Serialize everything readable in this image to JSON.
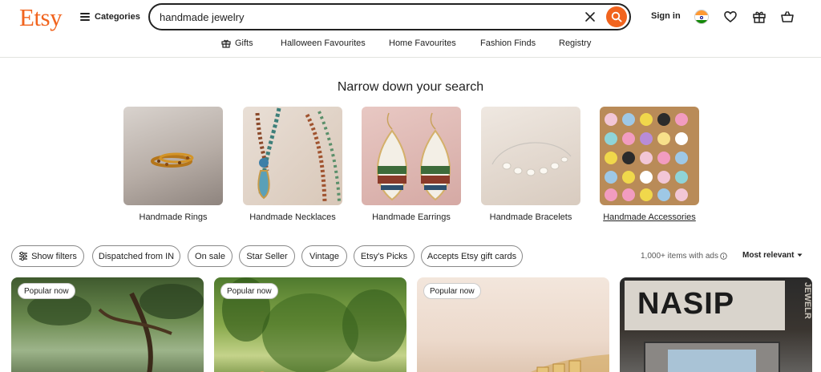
{
  "header": {
    "logo": "Etsy",
    "categories_label": "Categories",
    "search_value": "handmade jewelry",
    "signin_label": "Sign in"
  },
  "nav": {
    "items": [
      {
        "label": "Gifts"
      },
      {
        "label": "Halloween Favourites"
      },
      {
        "label": "Home Favourites"
      },
      {
        "label": "Fashion Finds"
      },
      {
        "label": "Registry"
      }
    ]
  },
  "narrow": {
    "title": "Narrow down your search",
    "items": [
      {
        "label": "Handmade Rings"
      },
      {
        "label": "Handmade Necklaces"
      },
      {
        "label": "Handmade Earrings"
      },
      {
        "label": "Handmade Bracelets"
      },
      {
        "label": "Handmade Accessories"
      }
    ]
  },
  "filters": {
    "show_filters": "Show filters",
    "chips": [
      "Dispatched from IN",
      "On sale",
      "Star Seller",
      "Vintage",
      "Etsy's Picks",
      "Accepts Etsy gift cards"
    ],
    "results_count": "1,000+ items with ads",
    "sort_label": "Most relevant"
  },
  "listings": [
    {
      "badge": "Popular now"
    },
    {
      "badge": "Popular now"
    },
    {
      "badge": "Popular now"
    },
    {
      "badge": "",
      "sign_text": "NASIP",
      "side_text": "JEWELR"
    }
  ],
  "colors": {
    "brand": "#f1641e",
    "text": "#222222",
    "border": "#e1e3df"
  }
}
